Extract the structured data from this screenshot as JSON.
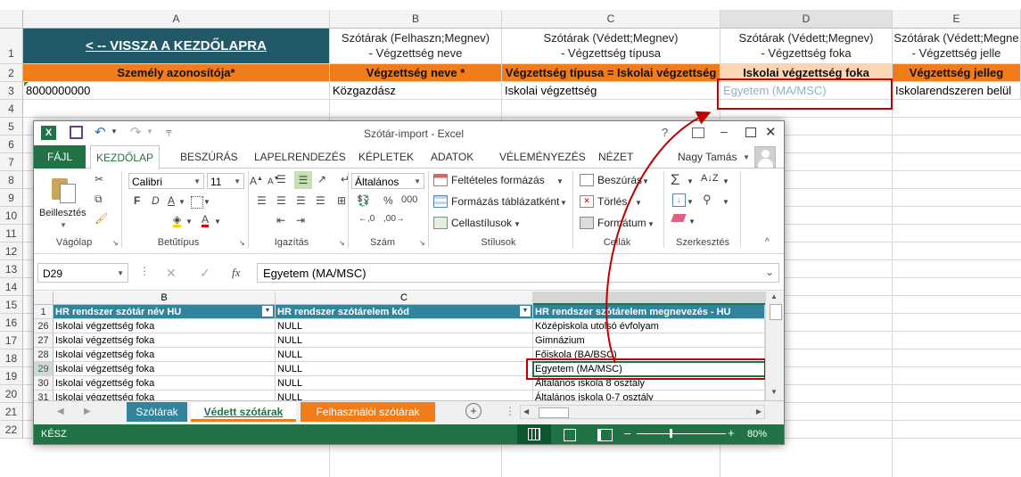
{
  "sheet": {
    "columns": [
      "A",
      "B",
      "C",
      "D",
      "E"
    ],
    "rows": [
      "1",
      "2",
      "3",
      "4",
      "5",
      "6",
      "7",
      "8",
      "9",
      "10",
      "11",
      "12",
      "13",
      "14",
      "15",
      "16",
      "17",
      "18",
      "19",
      "20",
      "21",
      "22"
    ],
    "back_link": "< -- VISSZA A KEZDŐLAPRA",
    "b1_line1": "Szótárak (Felhaszn;Megnev)",
    "b1_line2": "- Végzettség neve",
    "c1_line1": "Szótárak (Védett;Megnev)",
    "c1_line2": "- Végzettség típusa",
    "d1_line1": "Szótárak (Védett;Megnev)",
    "d1_line2": "- Végzettség foka",
    "e1_line1": "Szótárak (Védett;Megne",
    "e1_line2": "- Végzettség jelle",
    "h_a": "Személy azonosítója*",
    "h_b": "Végzettség neve *",
    "h_c": "Végzettség típusa = Iskolai végzettség",
    "h_d": "Iskolai végzettség foka",
    "h_e": "Végzettség jelleg",
    "r3_a": "8000000000",
    "r3_b": "Közgazdász",
    "r3_c": "Iskolai végzettség",
    "r3_d": "Egyetem (MA/MSC)",
    "r3_e": "Iskolarendszeren belül"
  },
  "excel": {
    "title": "Szótár-import - Excel",
    "user": "Nagy Tamás",
    "tabs": [
      "FÁJL",
      "KEZDŐLAP",
      "BESZÚRÁS",
      "LAPELRENDEZÉS",
      "KÉPLETEK",
      "ADATOK",
      "VÉLEMÉNYEZÉS",
      "NÉZET"
    ],
    "ribbon": {
      "paste": "Beillesztés",
      "font_name": "Calibri",
      "font_size": "11",
      "number_format": "Általános",
      "cond_format": "Feltételes formázás",
      "format_table": "Formázás táblázatként",
      "cell_styles": "Cellastílusok",
      "insert": "Beszúrás",
      "delete": "Törlés",
      "format": "Formátum",
      "groups": [
        "Vágólap",
        "Betűtípus",
        "Igazítás",
        "Szám",
        "Stílusok",
        "Cellák",
        "Szerkesztés"
      ]
    },
    "name_box": "D29",
    "formula": "Egyetem (MA/MSC)",
    "grid": {
      "col_b": "B",
      "col_c": "C",
      "headers": [
        "HR rendszer szótár név HU",
        "HR rendszer szótárelem kód",
        "HR rendszer  szótárelem megnevezés - HU"
      ],
      "header_row": "1",
      "rows": [
        {
          "n": "26",
          "b": "Iskolai végzettség foka",
          "c": "NULL",
          "d": "Középiskola utolsó évfolyam"
        },
        {
          "n": "27",
          "b": "Iskolai végzettség foka",
          "c": "NULL",
          "d": "Gimnázium"
        },
        {
          "n": "28",
          "b": "Iskolai végzettség foka",
          "c": "NULL",
          "d": "Főiskola (BA/BSC)"
        },
        {
          "n": "29",
          "b": "Iskolai végzettség foka",
          "c": "NULL",
          "d": "Egyetem (MA/MSC)"
        },
        {
          "n": "30",
          "b": "Iskolai végzettség foka",
          "c": "NULL",
          "d": "Általános iskola 8 osztály"
        },
        {
          "n": "31",
          "b": "Iskolai végzettség foka",
          "c": "NULL",
          "d": "Általános iskola 0-7 osztály"
        }
      ]
    },
    "sheet_tabs": [
      "Szótárak",
      "Védett szótárak",
      "Felhasználói szótárak"
    ],
    "status": "KÉSZ",
    "zoom": "80%"
  },
  "colors": {
    "teal_link": "#1f5c6e",
    "orange": "#f07c1a",
    "peach": "#fcd5b4",
    "red": "#c00000",
    "excel_green": "#217346"
  }
}
